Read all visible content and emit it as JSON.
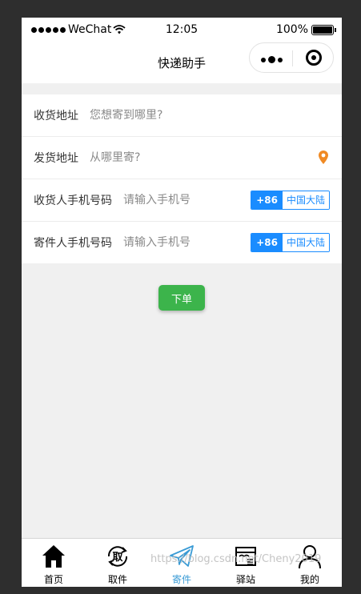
{
  "status_bar": {
    "carrier": "WeChat",
    "time": "12:05",
    "battery": "100%"
  },
  "nav": {
    "title": "快递助手",
    "menu_icon": "more-dots-icon",
    "close_icon": "target-icon"
  },
  "form": {
    "receive_address": {
      "label": "收货地址",
      "placeholder": "您想寄到哪里?"
    },
    "send_address": {
      "label": "发货地址",
      "placeholder": "从哪里寄?",
      "icon": "location-pin-icon",
      "icon_color": "#f08a24"
    },
    "receiver_phone": {
      "label": "收货人手机号码",
      "placeholder": "请输入手机号",
      "code": "+86",
      "region": "中国大陆"
    },
    "sender_phone": {
      "label": "寄件人手机号码",
      "placeholder": "请输入手机号",
      "code": "+86",
      "region": "中国大陆"
    }
  },
  "submit_label": "下单",
  "tabs": [
    {
      "label": "首页",
      "icon": "home-icon"
    },
    {
      "label": "取件",
      "icon": "pickup-icon"
    },
    {
      "label": "寄件",
      "icon": "send-plane-icon",
      "active": true
    },
    {
      "label": "驿站",
      "icon": "station-icon"
    },
    {
      "label": "我的",
      "icon": "user-icon"
    }
  ],
  "colors": {
    "accent": "#3cb44b",
    "blue": "#1a8cff",
    "active_tab": "#3a9bd5"
  },
  "watermark": "https://blog.csdn.net/Cheny2019"
}
